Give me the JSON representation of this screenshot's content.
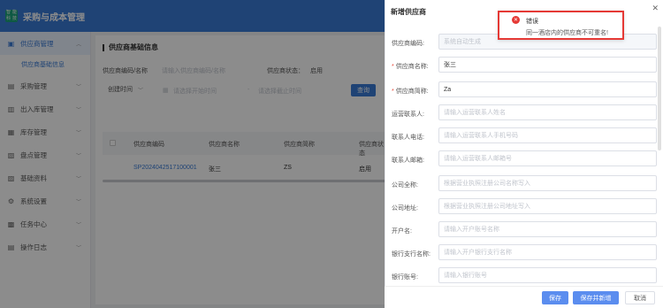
{
  "app": {
    "title": "采购与成本管理",
    "logo_text": "智能科技"
  },
  "sidebar": {
    "items": [
      {
        "label": "供应商管理",
        "icon": "supplier-icon",
        "glyph": "▣",
        "expanded": true
      },
      {
        "label": "采购管理",
        "icon": "cart-icon",
        "glyph": "▤"
      },
      {
        "label": "出入库管理",
        "icon": "warehouse-icon",
        "glyph": "▥"
      },
      {
        "label": "库存管理",
        "icon": "inventory-icon",
        "glyph": "▦"
      },
      {
        "label": "盘点管理",
        "icon": "checklist-icon",
        "glyph": "▧"
      },
      {
        "label": "基础资料",
        "icon": "database-icon",
        "glyph": "▨"
      },
      {
        "label": "系统设置",
        "icon": "gear-icon",
        "glyph": "⚙"
      },
      {
        "label": "任务中心",
        "icon": "task-icon",
        "glyph": "▩"
      },
      {
        "label": "操作日志",
        "icon": "log-icon",
        "glyph": "▤"
      }
    ],
    "sub_item": "供应商基础信息"
  },
  "main": {
    "section_title": "供应商基础信息",
    "filters": {
      "code_label": "供应商编码/名称",
      "code_placeholder": "请输入供应商编码/名称",
      "status_label": "供应商状态：",
      "status_value": "启用",
      "time_select": "创建时间",
      "start_placeholder": "请选择开始时间",
      "range_sep": "-",
      "end_placeholder": "请选择截止时间",
      "query_button": "查询"
    },
    "table": {
      "headers": [
        "供应商编码",
        "供应商名称",
        "供应商简称",
        "供应商状态"
      ],
      "rows": [
        [
          "SP2024042517100001",
          "张三",
          "ZS",
          "启用"
        ]
      ]
    }
  },
  "drawer": {
    "title": "新增供应商",
    "fields": [
      {
        "label": "供应商编码:",
        "value": "系统自动生成",
        "required": false,
        "state": "disabled"
      },
      {
        "label": "供应商名称:",
        "value": "张三",
        "required": true,
        "state": "filled"
      },
      {
        "label": "供应商简称:",
        "value": "Za",
        "required": true,
        "state": "filled"
      },
      {
        "label": "运营联系人:",
        "value": "请输入运营联系人姓名",
        "required": false,
        "state": "placeholder"
      },
      {
        "label": "联系人电话:",
        "value": "请输入运营联系人手机号码",
        "required": false,
        "state": "placeholder"
      },
      {
        "label": "联系人邮箱:",
        "value": "请输入运营联系人邮箱号",
        "required": false,
        "state": "placeholder"
      },
      {
        "label": "公司全称:",
        "value": "根据营业执照注册公司名称写入",
        "required": false,
        "state": "placeholder"
      },
      {
        "label": "公司地址:",
        "value": "根据营业执照注册公司地址写入",
        "required": false,
        "state": "placeholder"
      },
      {
        "label": "开户名:",
        "value": "请输入开户账号名称",
        "required": false,
        "state": "placeholder"
      },
      {
        "label": "银行支行名称:",
        "value": "请输入开户银行支行名称",
        "required": false,
        "state": "placeholder"
      },
      {
        "label": "银行账号:",
        "value": "请输入银行账号",
        "required": false,
        "state": "placeholder"
      }
    ],
    "buttons": {
      "save": "保存",
      "save_and_new": "保存并新增",
      "cancel": "取消"
    }
  },
  "toast": {
    "title": "错误",
    "message": "同一酒店内的供应商不可重名!",
    "icon": "error-icon",
    "color": "#e53935"
  },
  "colors": {
    "primary": "#3a7bd5",
    "error": "#e53935"
  }
}
